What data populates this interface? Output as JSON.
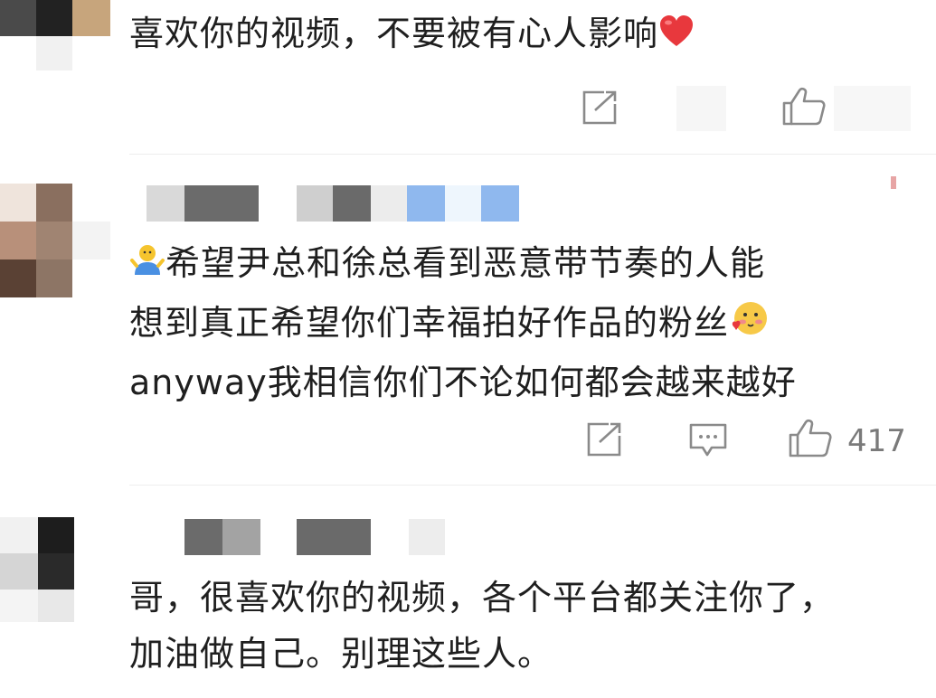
{
  "comments": [
    {
      "text_lines": [
        "喜欢你的视频，不要被有心人影响"
      ],
      "trailing_icon": "red-heart-icon",
      "actions": [
        "share-icon",
        "like-icon"
      ],
      "like_count": ""
    },
    {
      "text_lines": [
        "希望尹总和徐总看到恶意带节奏的人能",
        "想到真正希望你们幸福拍好作品的粉丝",
        "anyway我相信你们不论如何都会越来越好"
      ],
      "leading_icon": "waving-figure-emoji-icon",
      "trailing_icon": "blushing-face-emoji-icon",
      "actions": [
        "share-icon",
        "comment-icon",
        "like-icon"
      ],
      "like_count": "417"
    },
    {
      "text_lines": [
        "哥，很喜欢你的视频，各个平台都关注你了，",
        "加油做自己。别理这些人。"
      ]
    }
  ],
  "colors": {
    "heart": "#e8383d",
    "icon_gray": "#8a8a8a",
    "divider": "#eeeeee",
    "mosaic_blue": "#8fb8ee"
  }
}
